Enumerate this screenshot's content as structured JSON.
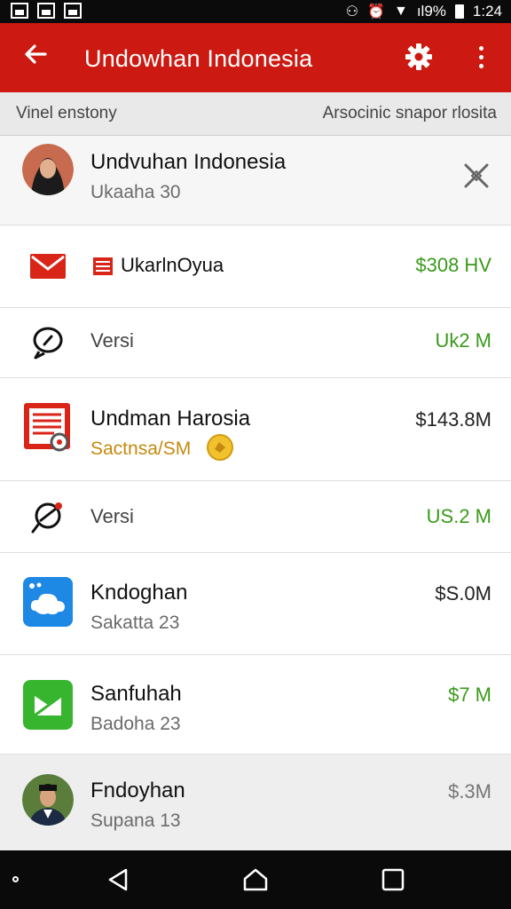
{
  "status": {
    "signal": "ıl9%",
    "time": "1:24"
  },
  "appbar": {
    "title": "Undowhan Indonesia",
    "icons": [
      "back-arrow-icon",
      "gear-icon",
      "more-vert-icon"
    ]
  },
  "subheader": {
    "left": "Vinel enstony",
    "right": "Arsocinic snapor rlosita"
  },
  "items": [
    {
      "title": "Undvuhan Indonesia",
      "subtitle": "Ukaaha 30",
      "amount": "",
      "icon": "user-avatar"
    },
    {
      "title": "UkarlnOyua",
      "subtitle": "",
      "amount": "$308 HV",
      "icon": "mail-icon"
    },
    {
      "title": "Versi",
      "subtitle": "",
      "amount": "Uk2 M",
      "icon": "chat-alert-icon"
    },
    {
      "title": "Undman Harosia",
      "subtitle": "Sactnsa/SM",
      "amount": "$143.8M",
      "icon": "document-icon"
    },
    {
      "title": "Versi",
      "subtitle": "",
      "amount": "US.2 M",
      "icon": "pin-icon"
    },
    {
      "title": "Kndoghan",
      "subtitle": "Sakatta 23",
      "amount": "$S.0M",
      "icon": "cloud-app-icon"
    },
    {
      "title": "Sanfuhah",
      "subtitle": "Badoha 23",
      "amount": "$7 M",
      "icon": "green-app-icon"
    },
    {
      "title": "Fndoyhan",
      "subtitle": "Supana 13",
      "amount": "$.3M",
      "icon": "user-avatar"
    }
  ],
  "colors": {
    "brand": "#cc1a12",
    "positive": "#3a9a1b",
    "accent_gold": "#c48a10"
  },
  "navbar": {
    "icons": [
      "back-triangle-icon",
      "home-icon",
      "recents-icon"
    ]
  }
}
